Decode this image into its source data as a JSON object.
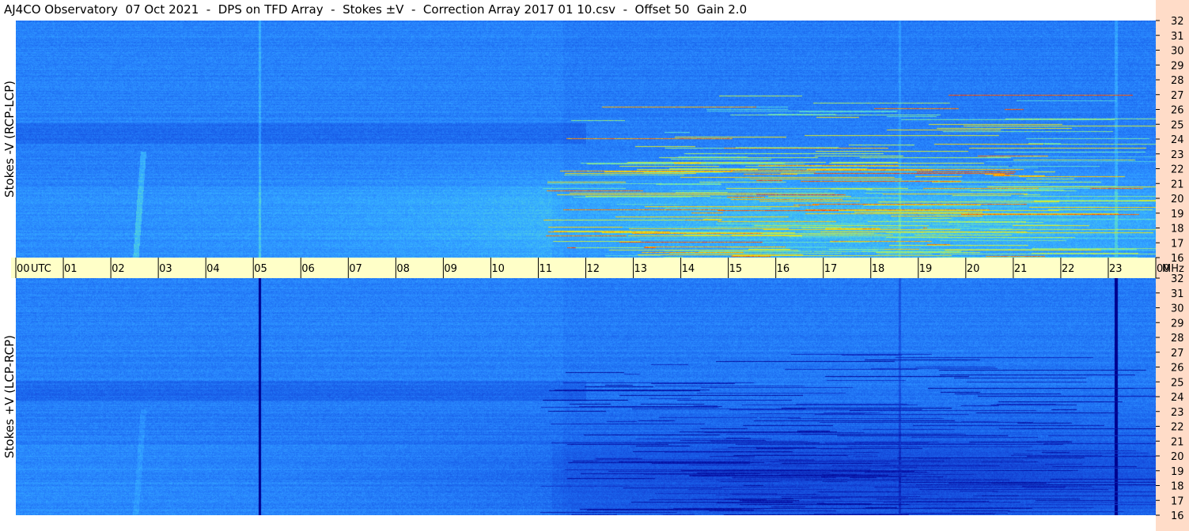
{
  "title": "AJ4CO Observatory  07 Oct 2021  -  DPS on TFD Array  -  Stokes ±V  -  Correction Array 2017 01 10.csv  -  Offset 50  Gain 2.0",
  "chart_data": [
    {
      "type": "heatmap",
      "panel": "top",
      "ylabel": "Stokes -V (RCP-LCP)",
      "x_ticks": [
        "00",
        "01",
        "02",
        "03",
        "04",
        "05",
        "06",
        "07",
        "08",
        "09",
        "10",
        "11",
        "12",
        "13",
        "14",
        "15",
        "16",
        "17",
        "18",
        "19",
        "20",
        "21",
        "22",
        "23",
        "00"
      ],
      "x_unit": "UTC",
      "xlim": [
        0,
        24
      ],
      "y_ticks": [
        "32",
        "31",
        "30",
        "29",
        "28",
        "27",
        "26",
        "25",
        "24",
        "23",
        "22",
        "21",
        "20",
        "19",
        "18",
        "17",
        "16"
      ],
      "y_unit": "MHz",
      "ylim": [
        16,
        32
      ],
      "colormap": [
        "#00008c",
        "#0a1fb4",
        "#1444d6",
        "#1a64ec",
        "#2a8aff",
        "#38b4ff",
        "#60e0c8",
        "#c8f040",
        "#ffd000",
        "#ff3000"
      ]
    },
    {
      "type": "heatmap",
      "panel": "bottom",
      "ylabel": "Stokes +V (LCP-RCP)",
      "x_ticks": [
        "00",
        "01",
        "02",
        "03",
        "04",
        "05",
        "06",
        "07",
        "08",
        "09",
        "10",
        "11",
        "12",
        "13",
        "14",
        "15",
        "16",
        "17",
        "18",
        "19",
        "20",
        "21",
        "22",
        "23",
        "00"
      ],
      "x_unit": "UTC",
      "xlim": [
        0,
        24
      ],
      "y_ticks": [
        "32",
        "31",
        "30",
        "29",
        "28",
        "27",
        "26",
        "25",
        "24",
        "23",
        "22",
        "21",
        "20",
        "19",
        "18",
        "17",
        "16"
      ],
      "y_unit": "MHz",
      "ylim": [
        16,
        32
      ],
      "colormap": [
        "#00008c",
        "#0a1fb4",
        "#1444d6",
        "#1a64ec",
        "#2a8aff",
        "#38b4ff",
        "#60e0c8",
        "#c8f040",
        "#ffd000",
        "#ff3000"
      ]
    }
  ],
  "colors": {
    "time_strip": "#ffffc8",
    "freq_strip": "#ffdcc8",
    "background": "#ffffff"
  }
}
